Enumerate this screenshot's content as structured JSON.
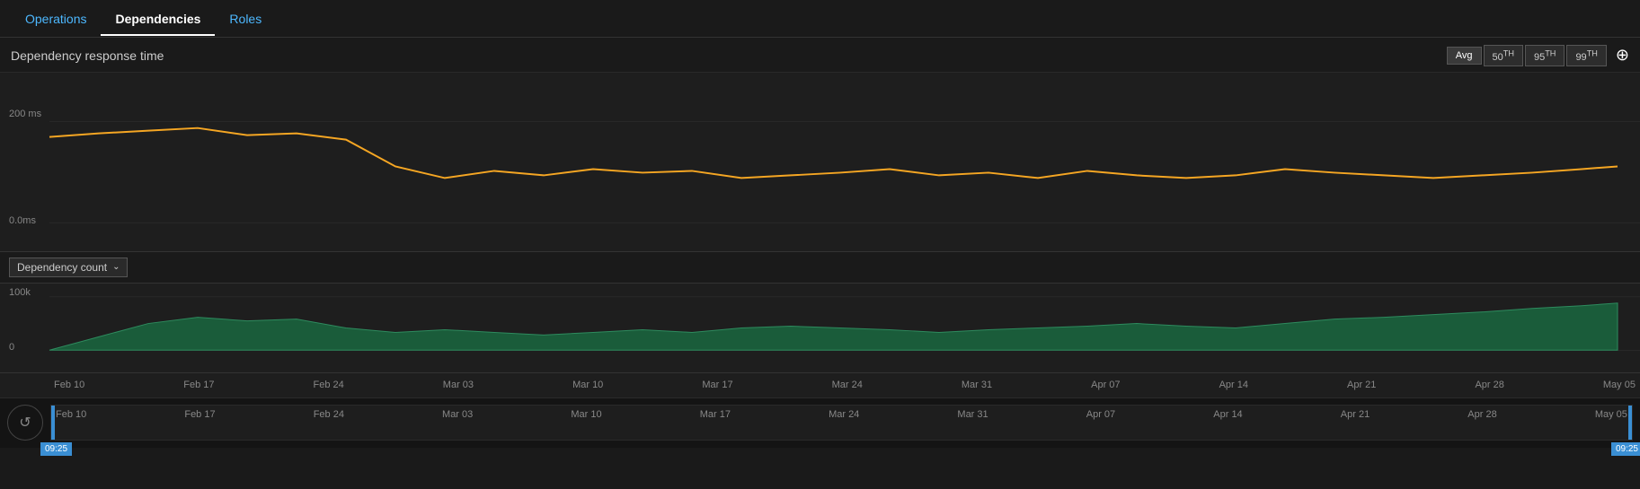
{
  "tabs": [
    {
      "label": "Operations",
      "active": false
    },
    {
      "label": "Dependencies",
      "active": true
    },
    {
      "label": "Roles",
      "active": false
    }
  ],
  "header": {
    "title": "Dependency response time",
    "buttons": [
      "Avg",
      "50TH",
      "95TH",
      "99TH"
    ],
    "active_button": "Avg",
    "pin_icon": "📌"
  },
  "upper_chart": {
    "y_labels": [
      "200 ms",
      "0.0ms"
    ]
  },
  "lower_section": {
    "dropdown_label": "Dependency count",
    "y_labels": [
      "100k",
      "0"
    ]
  },
  "x_axis_labels": [
    "Feb 10",
    "Feb 17",
    "Feb 24",
    "Mar 03",
    "Mar 10",
    "Mar 17",
    "Mar 24",
    "Mar 31",
    "Apr 07",
    "Apr 14",
    "Apr 21",
    "Apr 28",
    "May 05"
  ],
  "scrubber": {
    "labels": [
      "Feb 10",
      "Feb 17",
      "Feb 24",
      "Mar 03",
      "Mar 10",
      "Mar 17",
      "Mar 24",
      "Mar 31",
      "Apr 07",
      "Apr 14",
      "Apr 21",
      "Apr 28",
      "May 05"
    ],
    "time_left": "09:25",
    "time_right": "09:25",
    "reset_icon": "↺"
  }
}
